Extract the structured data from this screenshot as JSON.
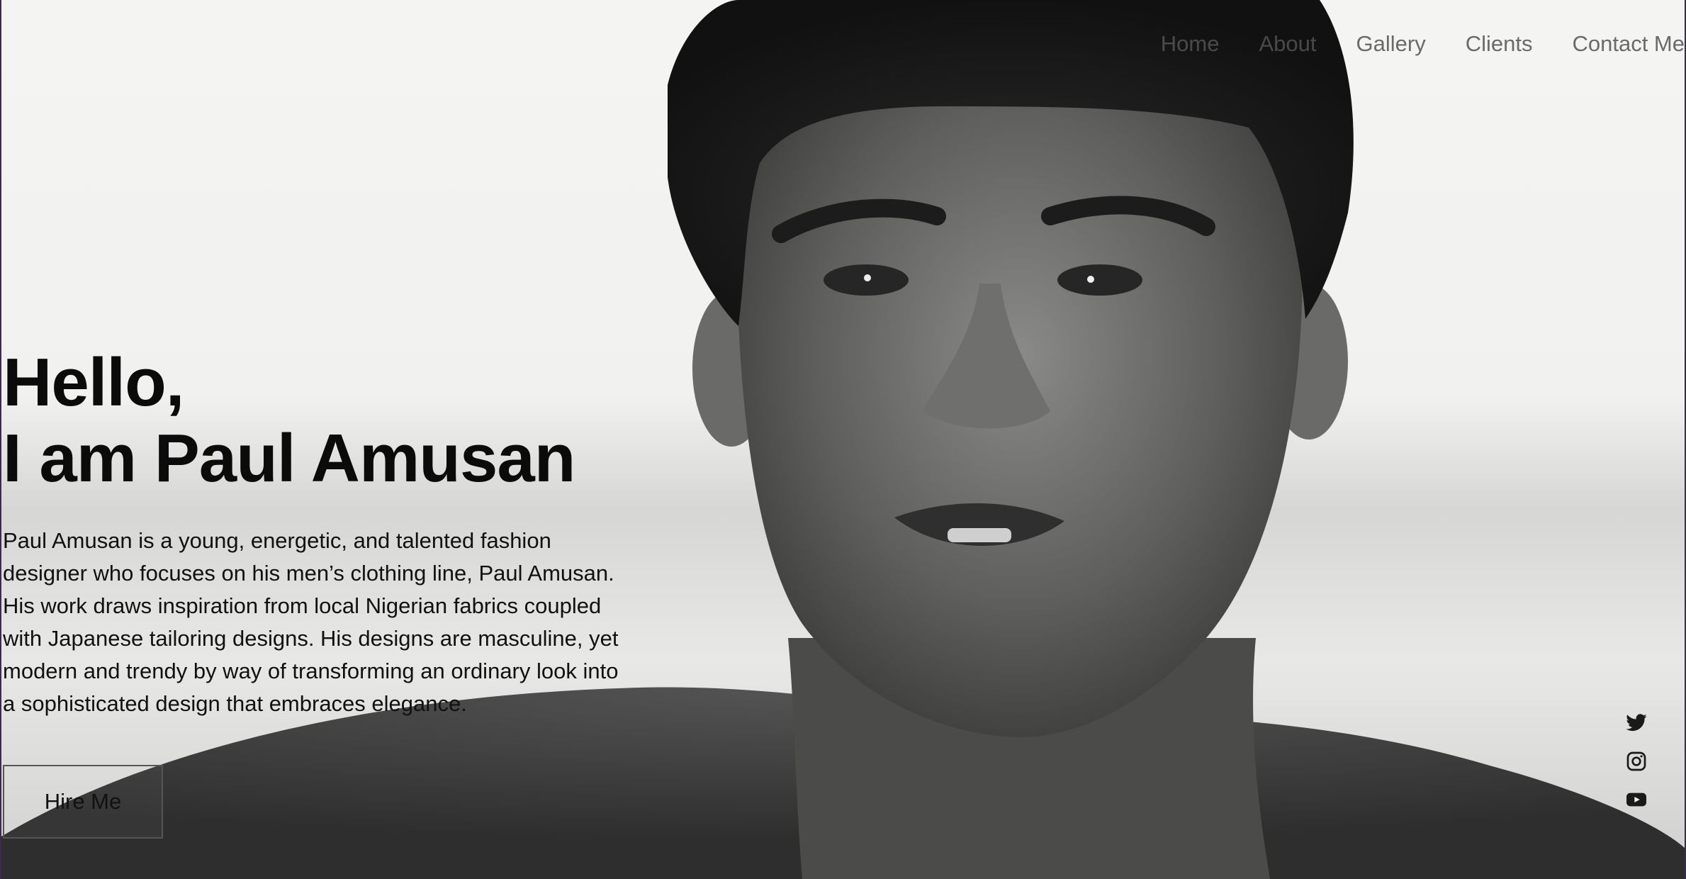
{
  "nav": {
    "items": [
      {
        "label": "Home",
        "faded": true
      },
      {
        "label": "About",
        "faded": true
      },
      {
        "label": "Gallery",
        "faded": false
      },
      {
        "label": "Clients",
        "faded": false
      },
      {
        "label": "Contact Me",
        "faded": false
      }
    ]
  },
  "hero": {
    "greeting": "Hello,",
    "name_line": "I am Paul Amusan",
    "bio": "Paul Amusan is a young, energetic, and talented fashion designer who focuses on his men’s clothing line, Paul Amusan. His work draws inspiration from local Nigerian fabrics coupled with Japanese tailoring designs. His designs are masculine, yet modern and trendy by way of transforming an ordinary look into a sophisticated design that embraces elegance.",
    "cta_label": "Hire Me"
  },
  "social": {
    "icons": [
      "twitter-icon",
      "instagram-icon",
      "youtube-icon"
    ]
  },
  "colors": {
    "text": "#0b0b0b",
    "nav": "#6a6a6a",
    "frame": "#3b2a55"
  }
}
